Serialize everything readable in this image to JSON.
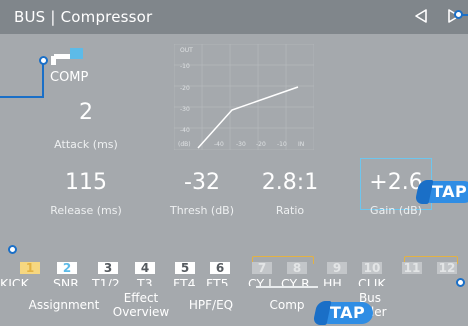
{
  "header": {
    "title": "BUS | Compressor"
  },
  "comp": {
    "label": "COMP"
  },
  "attack": {
    "value": "2",
    "label": "Attack (ms)"
  },
  "release": {
    "value": "115",
    "label": "Release (ms)"
  },
  "thresh": {
    "value": "-32",
    "label": "Thresh (dB)"
  },
  "ratio": {
    "value": "2.8:1",
    "label": "Ratio"
  },
  "gain": {
    "value": "+2.6",
    "label": "Gain (dB)"
  },
  "graph": {
    "out_label": "OUT",
    "y_ticks": [
      "-10",
      "-20",
      "-30",
      "-40"
    ],
    "x_ticks": [
      "(dB)",
      "-40",
      "-30",
      "-20",
      "-10",
      "IN"
    ]
  },
  "channels": [
    {
      "num": "1",
      "name": "KICK",
      "state": "selected-yellow"
    },
    {
      "num": "2",
      "name": "SNR",
      "state": "selected-blue"
    },
    {
      "num": "3",
      "name": "T1/2",
      "state": "on"
    },
    {
      "num": "4",
      "name": "T3",
      "state": "on"
    },
    {
      "num": "5",
      "name": "FT4",
      "state": "on"
    },
    {
      "num": "6",
      "name": "FT5",
      "state": "on"
    },
    {
      "num": "7",
      "name": "CY L",
      "state": "dim"
    },
    {
      "num": "8",
      "name": "CY R",
      "state": "dim"
    },
    {
      "num": "9",
      "name": "HH",
      "state": "dim"
    },
    {
      "num": "10",
      "name": "CLIK",
      "state": "dim"
    },
    {
      "num": "11",
      "name": "",
      "state": "dim"
    },
    {
      "num": "12",
      "name": "",
      "state": "dim"
    }
  ],
  "tabs": [
    {
      "line1": "Assignment",
      "line2": ""
    },
    {
      "line1": "Effect",
      "line2": "Overview"
    },
    {
      "line1": "HPF/EQ",
      "line2": ""
    },
    {
      "line1": "Comp",
      "line2": ""
    },
    {
      "line1": "Bus",
      "line2": "Fader"
    }
  ],
  "callouts": {
    "tap_label": "TAP"
  },
  "colors": {
    "accent_blue": "#6ec6ee",
    "callout_blue": "#2f8de4",
    "link_yellow": "#e3b243"
  }
}
